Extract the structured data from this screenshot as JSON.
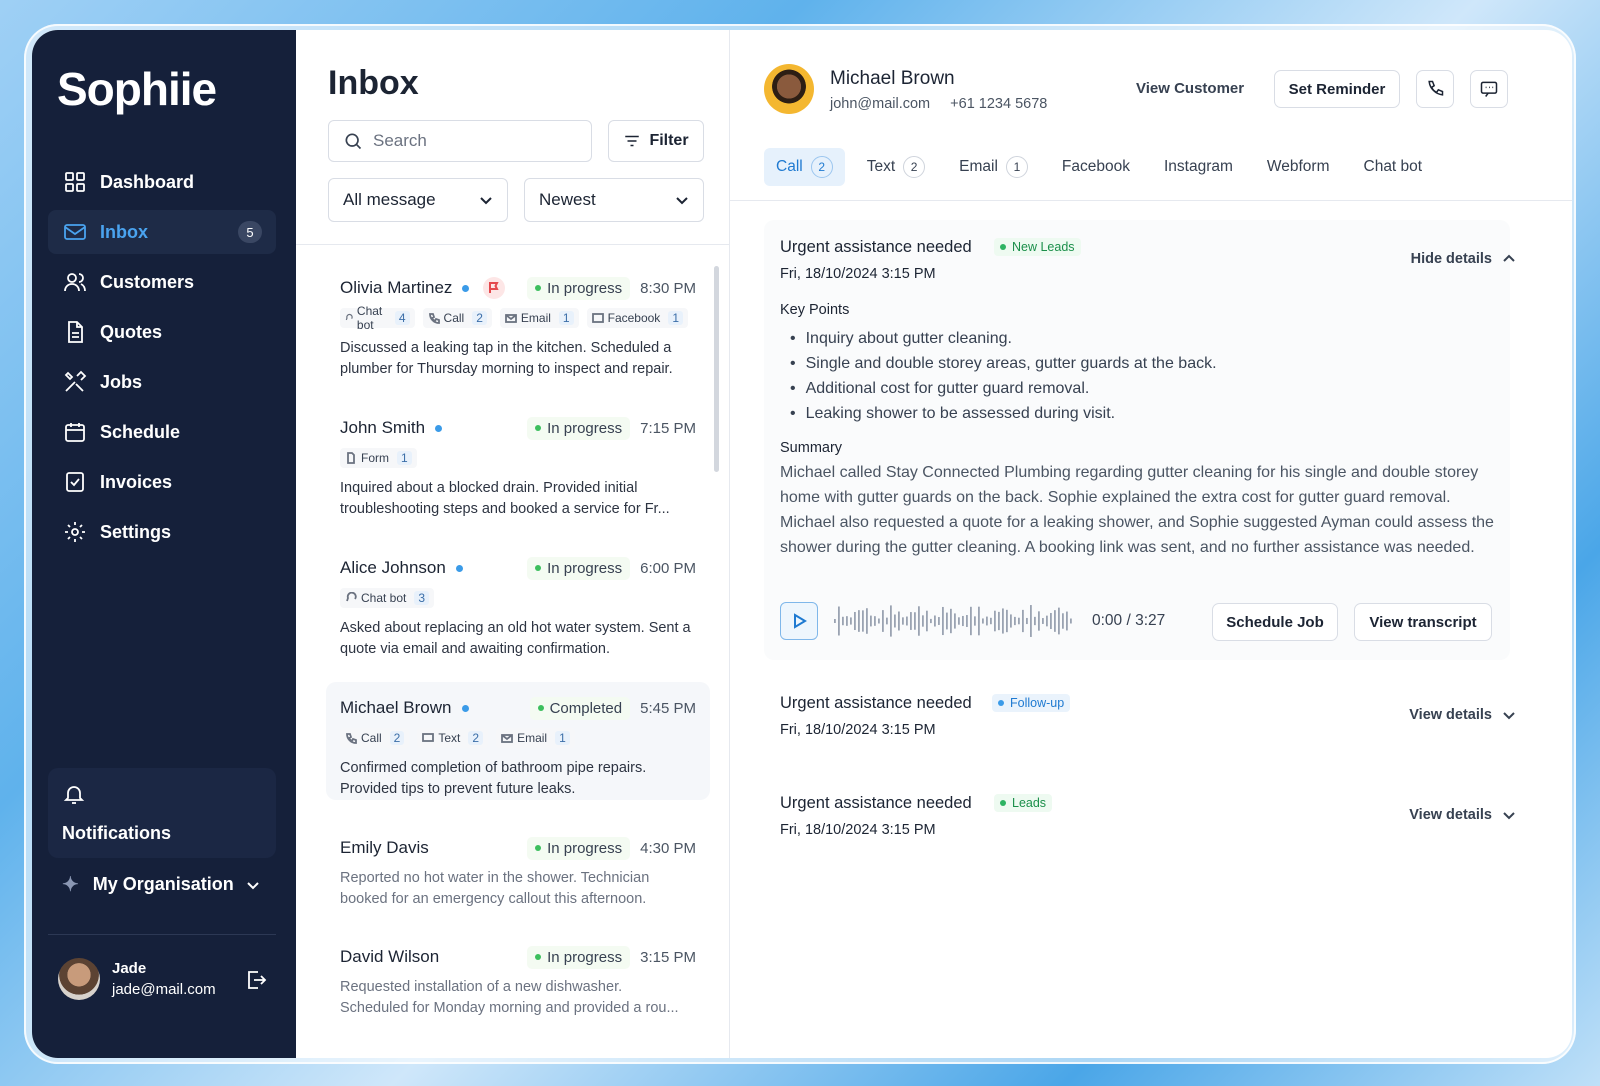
{
  "sidebar": {
    "logo": "Sophiie",
    "items": [
      {
        "label": "Dashboard"
      },
      {
        "label": "Inbox",
        "badge": "5"
      },
      {
        "label": "Customers"
      },
      {
        "label": "Quotes"
      },
      {
        "label": "Jobs"
      },
      {
        "label": "Schedule"
      },
      {
        "label": "Invoices"
      },
      {
        "label": "Settings"
      }
    ],
    "notifications": "Notifications",
    "organisation": "My Organisation",
    "user": {
      "name": "Jade",
      "email": "jade@mail.com"
    }
  },
  "inbox": {
    "title": "Inbox",
    "search_placeholder": "Search",
    "filter_label": "Filter",
    "message_filter": "All message",
    "sort": "Newest",
    "messages": [
      {
        "name": "Olivia Martinez",
        "status": "In progress",
        "time": "8:30 PM",
        "channels": [
          {
            "label": "Chat bot",
            "count": "4"
          },
          {
            "label": "Call",
            "count": "2"
          },
          {
            "label": "Email",
            "count": "1"
          },
          {
            "label": "Facebook",
            "count": "1"
          }
        ],
        "body": "Discussed a leaking tap in the kitchen. Scheduled a plumber for Thursday morning to inspect and repair."
      },
      {
        "name": "John Smith",
        "status": "In progress",
        "time": "7:15 PM",
        "channels": [
          {
            "label": "Form",
            "count": "1"
          }
        ],
        "body": "Inquired about a blocked drain. Provided initial troubleshooting steps and booked a service for Fr..."
      },
      {
        "name": "Alice Johnson",
        "status": "In progress",
        "time": "6:00 PM",
        "channels": [
          {
            "label": "Chat bot",
            "count": "3"
          }
        ],
        "body": "Asked about replacing an old hot water system. Sent a quote via email and awaiting confirmation."
      },
      {
        "name": "Michael Brown",
        "status": "Completed",
        "time": "5:45 PM",
        "channels": [
          {
            "label": "Call",
            "count": "2"
          },
          {
            "label": "Text",
            "count": "2"
          },
          {
            "label": "Email",
            "count": "1"
          }
        ],
        "body": "Confirmed completion of bathroom pipe repairs. Provided tips to prevent future leaks."
      },
      {
        "name": "Emily Davis",
        "status": "In progress",
        "time": "4:30 PM",
        "body": "Reported no hot water in the shower. Technician booked for an emergency callout this afternoon."
      },
      {
        "name": "David Wilson",
        "status": "In progress",
        "time": "3:15 PM",
        "body": "Requested installation of a new dishwasher. Scheduled for Monday morning and provided a rou..."
      }
    ]
  },
  "detail": {
    "customer": {
      "name": "Michael Brown",
      "email": "john@mail.com",
      "phone": "+61 1234 5678"
    },
    "view_customer": "View Customer",
    "set_reminder": "Set Reminder",
    "tabs": [
      {
        "label": "Call",
        "count": "2"
      },
      {
        "label": "Text",
        "count": "2"
      },
      {
        "label": "Email",
        "count": "1"
      },
      {
        "label": "Facebook"
      },
      {
        "label": "Instagram"
      },
      {
        "label": "Webform"
      },
      {
        "label": "Chat bot"
      }
    ],
    "conversations": [
      {
        "title": "Urgent assistance needed",
        "tag": "New Leads",
        "date": "Fri, 18/10/2024 3:15 PM",
        "toggle": "Hide details",
        "key_points_label": "Key Points",
        "key_points": [
          "Inquiry about gutter cleaning.",
          "Single and double storey areas, gutter guards at the back.",
          "Additional cost for gutter guard removal.",
          "Leaking shower to be assessed during visit."
        ],
        "summary_label": "Summary",
        "summary": "Michael called Stay Connected Plumbing regarding gutter cleaning for his single and double storey home with gutter guards on the back. Sophie explained the extra cost for gutter guard removal. Michael also requested a quote for a leaking shower, and Sophie suggested Ayman could assess the shower during the gutter cleaning. A booking link was sent, and no further assistance was needed.",
        "audio_time": "0:00 / 3:27",
        "schedule_job": "Schedule Job",
        "view_transcript": "View transcript"
      },
      {
        "title": "Urgent assistance needed",
        "tag": "Follow-up",
        "date": "Fri, 18/10/2024 3:15 PM",
        "toggle": "View details"
      },
      {
        "title": "Urgent assistance needed",
        "tag": "Leads",
        "date": "Fri, 18/10/2024 3:15 PM",
        "toggle": "View details"
      }
    ]
  },
  "colors": {
    "sidebar_bg": "#15203a",
    "accent": "#1f7ad1",
    "status_green": "#3cbf5d",
    "unread_dot": "#3b9be8",
    "flag_red": "#e5484d"
  },
  "icons": [
    "dashboard-icon",
    "inbox-icon",
    "customers-icon",
    "quotes-icon",
    "jobs-icon",
    "schedule-icon",
    "invoices-icon",
    "settings-icon",
    "bell-icon",
    "sparkle-icon",
    "logout-icon",
    "search-icon",
    "filter-icon",
    "phone-icon",
    "message-icon",
    "play-icon"
  ]
}
